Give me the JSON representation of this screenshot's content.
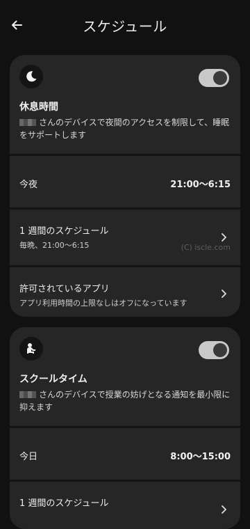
{
  "header": {
    "title": "スケジュール"
  },
  "bedtime": {
    "title": "休息時間",
    "desc_line1": "さんのデバイスで夜間のアクセスを制限して、睡眠",
    "desc_line2": "をサポートします",
    "toggle_on": true,
    "tonight_label": "今夜",
    "tonight_value": "21:00〜6:15",
    "weekly_label": "1 週間のスケジュール",
    "weekly_sub": "毎晩、21:00〜6:15",
    "allowed_label": "許可されているアプリ",
    "allowed_sub": "アプリ利用時間の上限なしはオフになっています"
  },
  "schooltime": {
    "title": "スクールタイム",
    "desc_line1": "さんのデバイスで授業の妨げとなる通知を最小限に",
    "desc_line2": "抑えます",
    "toggle_on": true,
    "today_label": "今日",
    "today_value": "8:00〜15:00",
    "weekly_label": "1 週間のスケジュール"
  },
  "watermark": "(C) iscle.com"
}
